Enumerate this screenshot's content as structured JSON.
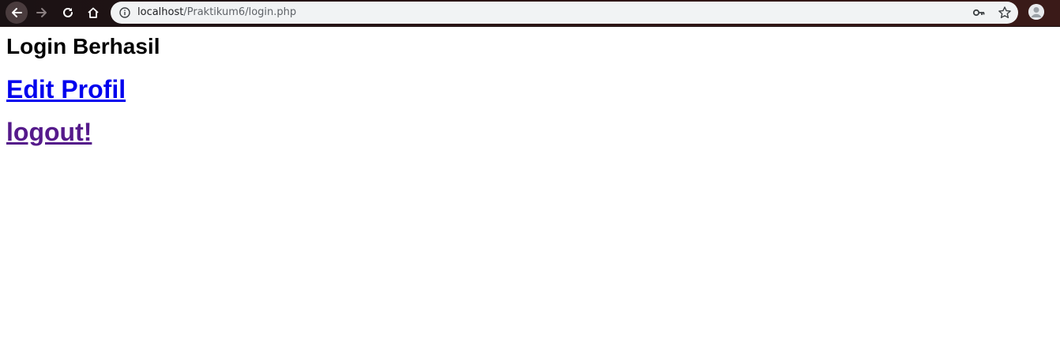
{
  "browser": {
    "url_host": "localhost",
    "url_path": "/Praktikum6/login.php",
    "icons": {
      "back": "back-arrow-icon",
      "forward": "forward-arrow-icon",
      "reload": "reload-icon",
      "home": "home-icon",
      "info": "info-icon",
      "key": "key-icon",
      "star": "star-icon",
      "avatar": "avatar-icon"
    }
  },
  "page": {
    "heading": "Login Berhasil",
    "links": [
      {
        "label": "Edit Profil",
        "color": "#0000ee"
      },
      {
        "label": "logout!",
        "color": "#551a8b"
      }
    ]
  }
}
